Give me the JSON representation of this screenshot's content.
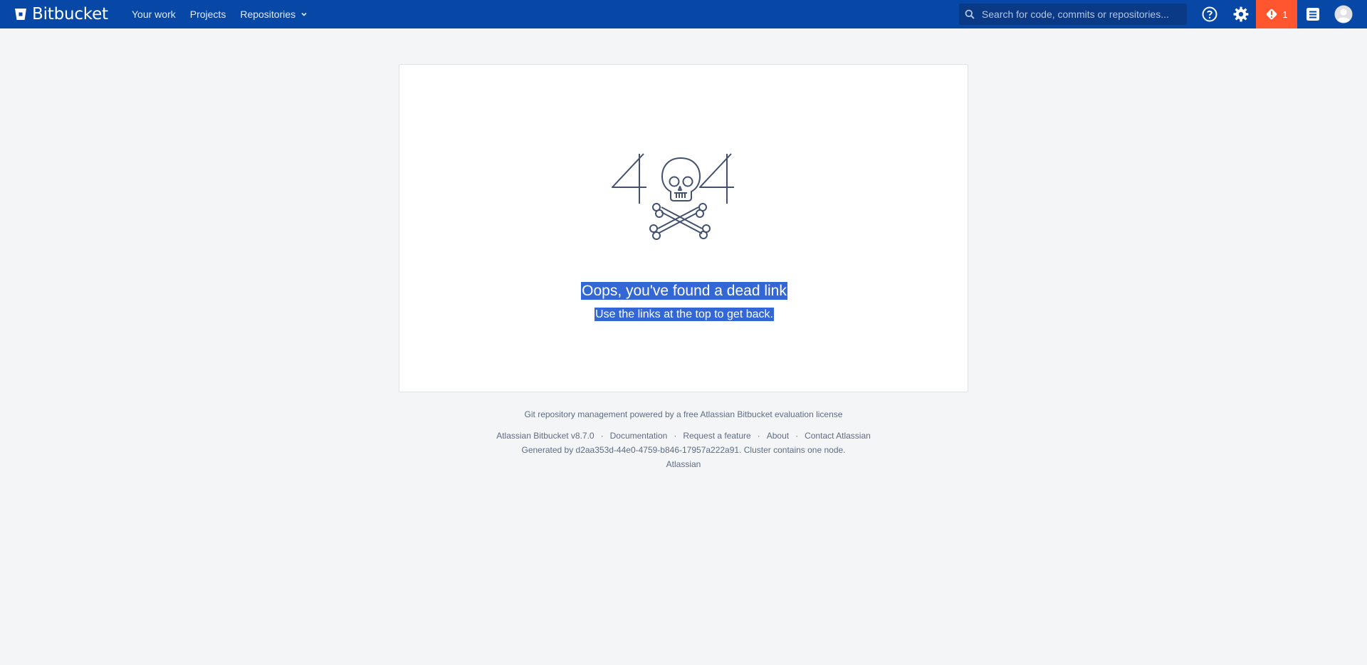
{
  "header": {
    "logo_text": "Bitbucket",
    "nav": {
      "your_work": "Your work",
      "projects": "Projects",
      "repositories": "Repositories"
    },
    "search_placeholder": "Search for code, commits or repositories...",
    "alert_count": "1",
    "icons": [
      "search-icon",
      "help-icon",
      "gear-icon",
      "alert-icon",
      "notes-icon",
      "avatar"
    ]
  },
  "error": {
    "code": "404",
    "title": "Oops, you've found a dead link",
    "subtitle": "Use the links at the top to get back."
  },
  "footer": {
    "license": "Git repository management powered by a free Atlassian Bitbucket evaluation license",
    "version": "Atlassian Bitbucket v8.7.0",
    "documentation": "Documentation",
    "request_feature": "Request a feature",
    "about": "About",
    "contact": "Contact Atlassian",
    "generated": "Generated by d2aa353d-44e0-4759-b846-17957a222a91. Cluster contains one node.",
    "atlassian": "Atlassian",
    "separator": "·"
  },
  "colors": {
    "header_bg": "#0747a6",
    "alert_bg": "#ff5630",
    "selection": "#3367d6"
  }
}
